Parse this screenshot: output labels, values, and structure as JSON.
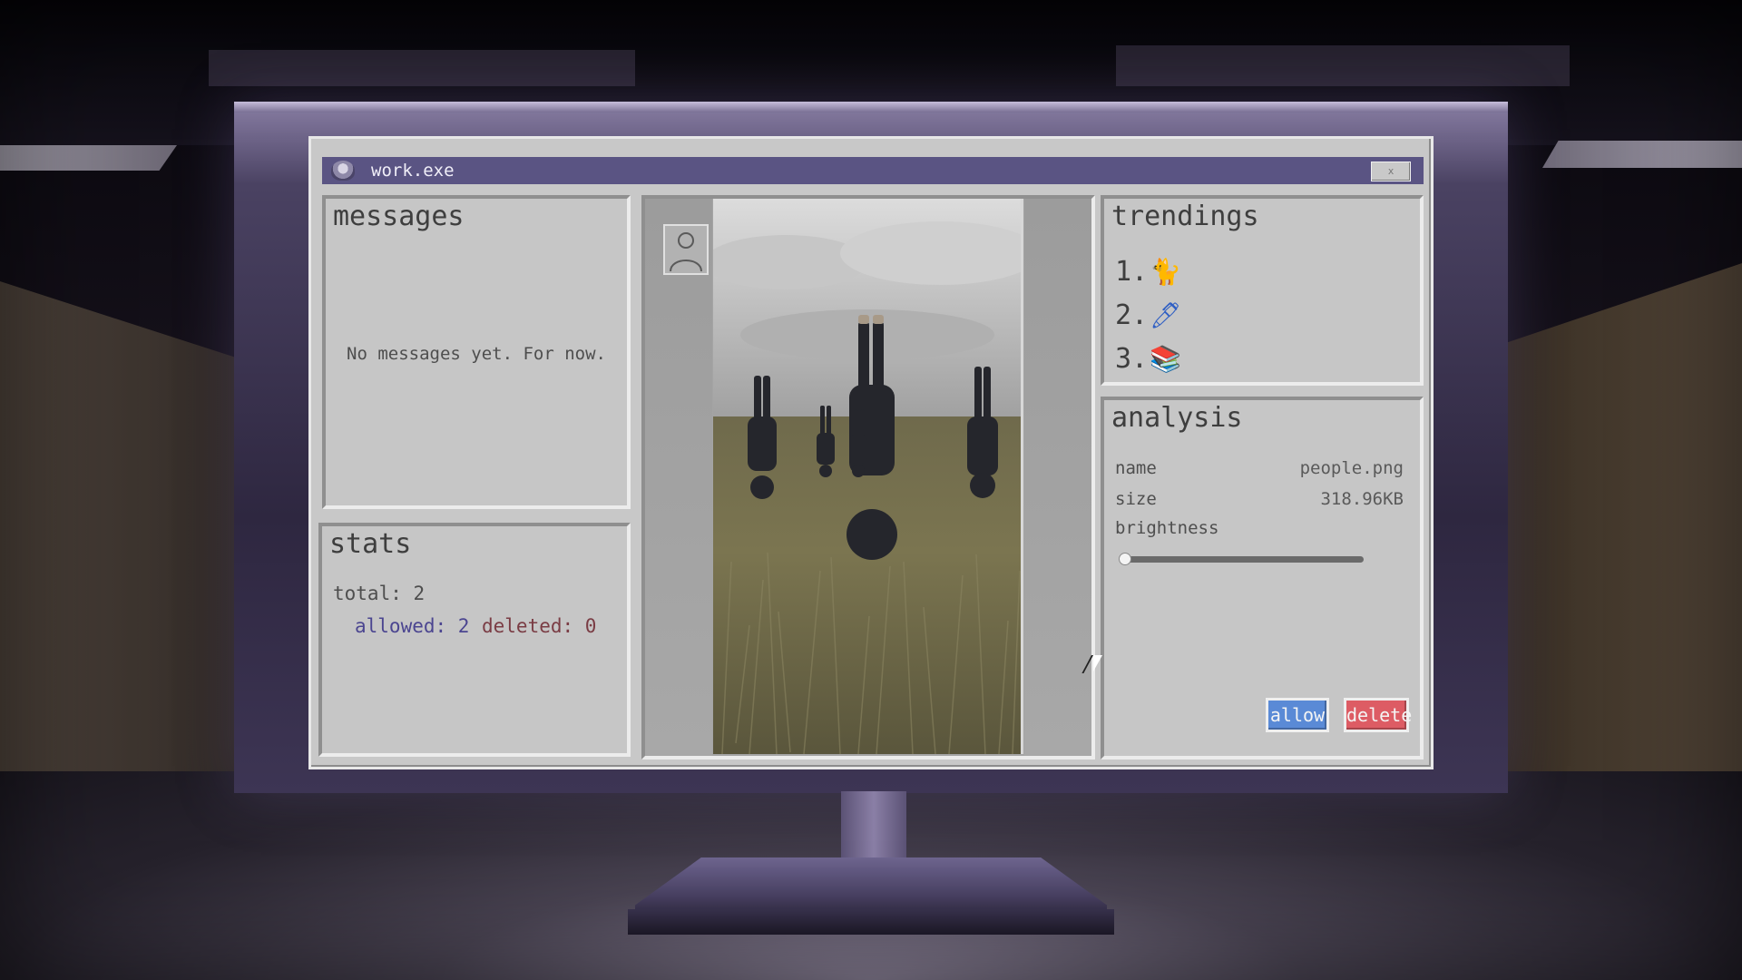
{
  "window": {
    "title": "work.exe",
    "close_label": "x"
  },
  "messages": {
    "title": "messages",
    "empty_text": "No messages yet. For now."
  },
  "stats": {
    "title": "stats",
    "total": "total: 2",
    "allowed": "allowed: 2",
    "deleted": "deleted: 0"
  },
  "trendings": {
    "title": "trendings",
    "items": [
      {
        "num": "1.",
        "emoji": "🐈",
        "icon": "cat-icon"
      },
      {
        "num": "2.",
        "emoji": "🖊",
        "icon": "pen-icon"
      },
      {
        "num": "3.",
        "emoji": "📚",
        "icon": "books-icon"
      }
    ]
  },
  "analysis": {
    "title": "analysis",
    "name_label": "name",
    "name_value": "people.png",
    "size_label": "size",
    "size_value": "318.96KB",
    "brightness_label": "brightness",
    "brightness_level": 0.02,
    "allow_label": "allow",
    "delete_label": "delete"
  },
  "colors": {
    "titlebar": "#5a5483",
    "allow": "#5a8ad6",
    "delete": "#dd5c64",
    "allowed_text": "#4b4590",
    "deleted_text": "#7a3c44"
  }
}
